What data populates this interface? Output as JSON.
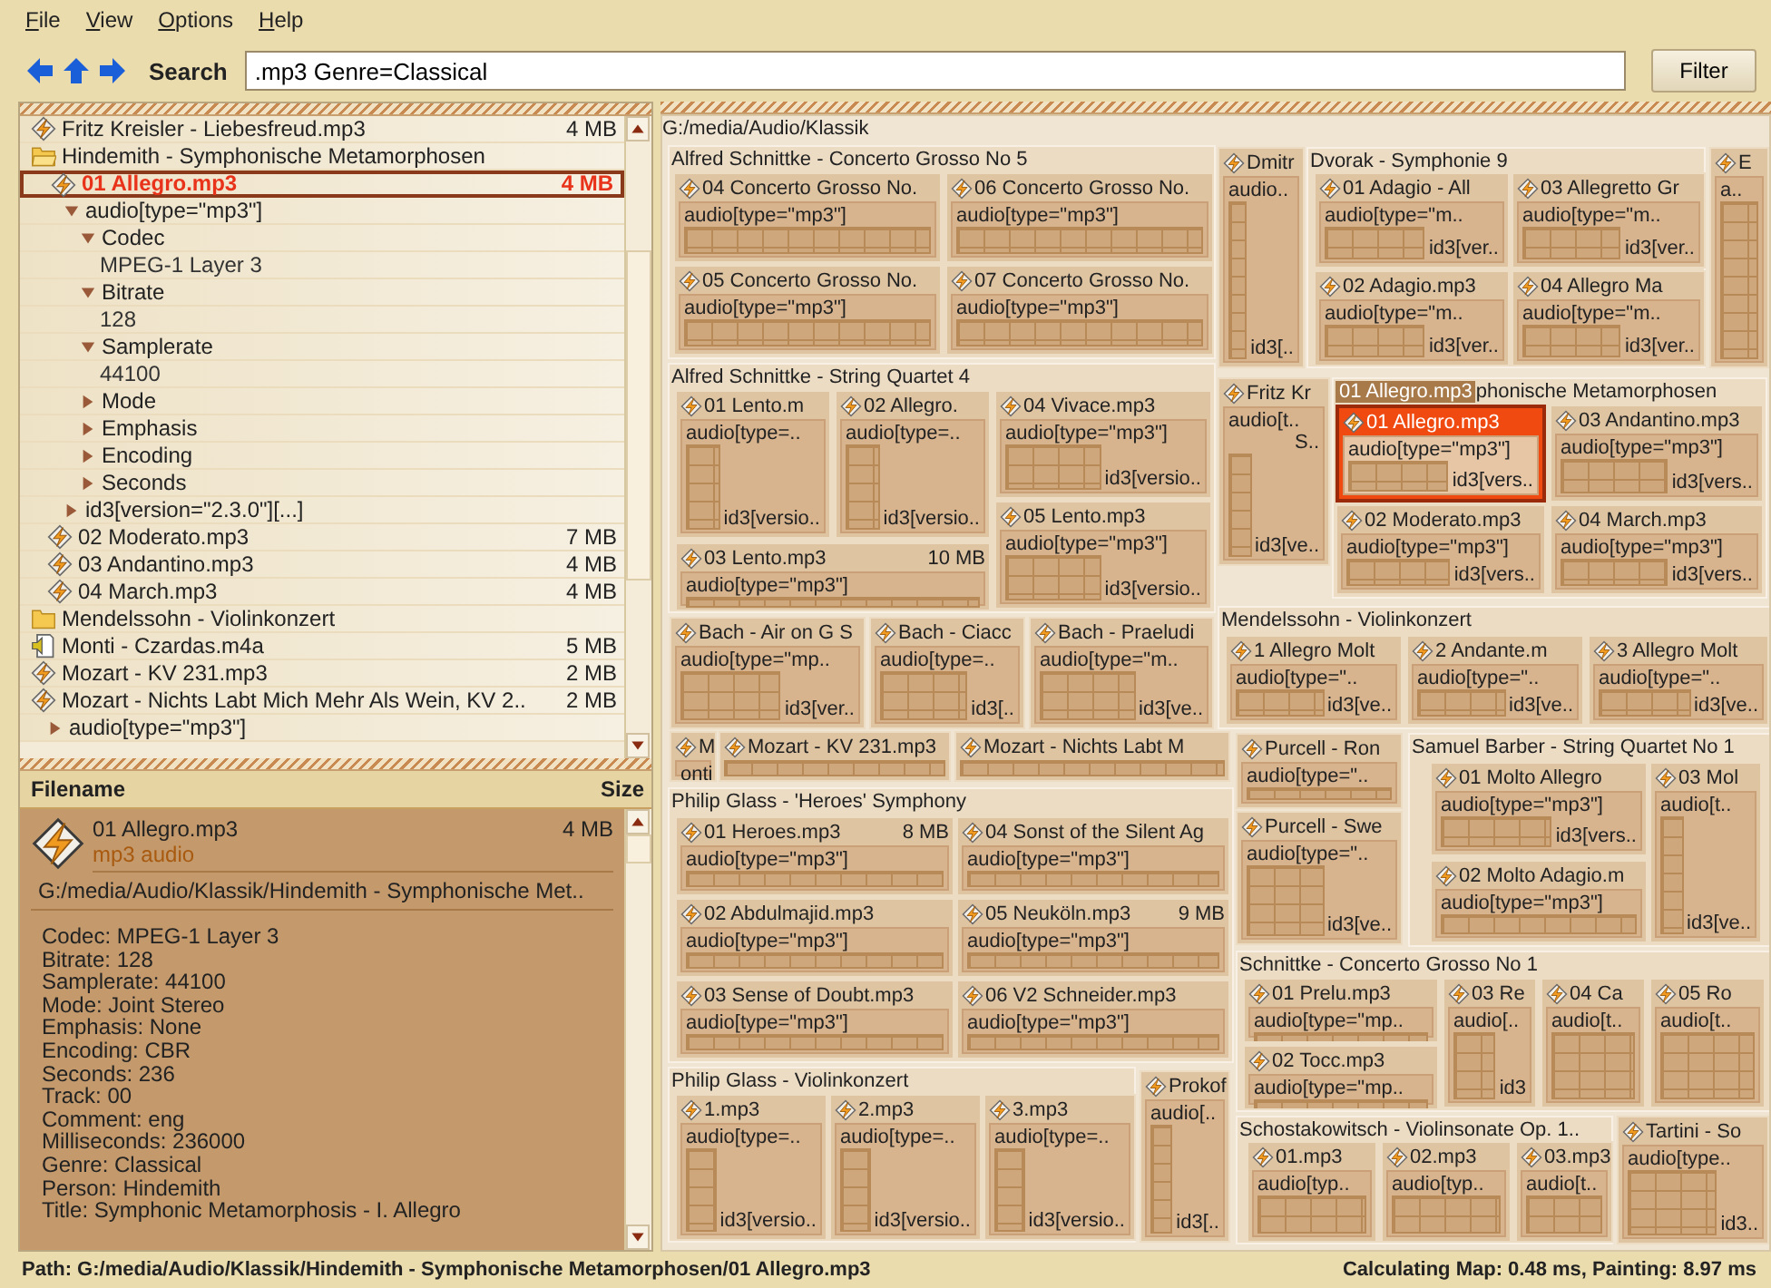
{
  "menu": [
    "File",
    "View",
    "Options",
    "Help"
  ],
  "toolbar": {
    "search_label": "Search",
    "search_value": ".mp3 Genre=Classical",
    "filter_button": "Filter"
  },
  "tree": [
    {
      "kind": "file",
      "name": "Fritz Kreisler - Liebesfreud.mp3",
      "size": "4 MB",
      "selected": false
    },
    {
      "kind": "folder",
      "name": "Hindemith - Symphonische Metamorphosen",
      "expanded": true,
      "children": [
        {
          "kind": "file",
          "name": "01 Allegro.mp3",
          "size": "4 MB",
          "selected": true,
          "children": [
            {
              "kind": "node",
              "name": "audio[type=\"mp3\"]",
              "expanded": true,
              "children": [
                {
                  "kind": "node",
                  "name": "Codec",
                  "expanded": true,
                  "children": [
                    {
                      "kind": "value",
                      "name": "MPEG-1 Layer 3"
                    }
                  ]
                },
                {
                  "kind": "node",
                  "name": "Bitrate",
                  "expanded": true,
                  "children": [
                    {
                      "kind": "value",
                      "name": "128"
                    }
                  ]
                },
                {
                  "kind": "node",
                  "name": "Samplerate",
                  "expanded": true,
                  "children": [
                    {
                      "kind": "value",
                      "name": "44100"
                    }
                  ]
                },
                {
                  "kind": "node",
                  "name": "Mode",
                  "expanded": false
                },
                {
                  "kind": "node",
                  "name": "Emphasis",
                  "expanded": false
                },
                {
                  "kind": "node",
                  "name": "Encoding",
                  "expanded": false
                },
                {
                  "kind": "node",
                  "name": "Seconds",
                  "expanded": false
                }
              ]
            },
            {
              "kind": "node",
              "name": "id3[version=\"2.3.0\"][...]",
              "expanded": false
            }
          ]
        },
        {
          "kind": "file",
          "name": "02 Moderato.mp3",
          "size": "7 MB",
          "selected": false
        },
        {
          "kind": "file",
          "name": "03 Andantino.mp3",
          "size": "4 MB",
          "selected": false
        },
        {
          "kind": "file",
          "name": "04 March.mp3",
          "size": "4 MB",
          "selected": false
        }
      ]
    },
    {
      "kind": "folder",
      "name": "Mendelssohn - Violinkonzert",
      "expanded": false
    },
    {
      "kind": "m4a",
      "name": "Monti - Czardas.m4a",
      "size": "5 MB",
      "selected": false
    },
    {
      "kind": "file",
      "name": "Mozart - KV 231.mp3",
      "size": "2 MB",
      "selected": false
    },
    {
      "kind": "file",
      "name": "Mozart - Nichts Labt Mich Mehr Als Wein, KV 2..",
      "size": "2 MB",
      "selected": false,
      "children": [
        {
          "kind": "node",
          "name": "audio[type=\"mp3\"]",
          "expanded": false
        }
      ]
    }
  ],
  "details": {
    "header_name": "Filename",
    "header_size": "Size",
    "name": "01 Allegro.mp3",
    "size": "4 MB",
    "type": "mp3 audio",
    "path": "G:/media/Audio/Klassik/Hindemith - Symphonische Met..",
    "properties": [
      "Codec: MPEG-1 Layer 3",
      "Bitrate: 128",
      "Samplerate: 44100",
      "Mode: Joint Stereo",
      "Emphasis: None",
      "Encoding: CBR",
      "Seconds: 236",
      "Track: 00",
      "Comment: eng",
      "Milliseconds: 236000",
      "Genre: Classical",
      "Person: Hindemith",
      "Title: Symphonic Metamorphosis - I. Allegro"
    ]
  },
  "treemap": {
    "root": "G:/media/Audio/Klassik",
    "tooltip": "01 Allegro.mp3",
    "items": [
      {
        "kind": "folder",
        "title": "Alfred Schnittke - Concerto Grosso No 5",
        "files": [
          {
            "name": "04 Concerto Grosso No.",
            "audio": "audio[type=\"mp3\"]",
            "selected": false
          },
          {
            "name": "06 Concerto Grosso No.",
            "audio": "audio[type=\"mp3\"]",
            "selected": false
          },
          {
            "name": "05 Concerto Grosso No.",
            "audio": "audio[type=\"mp3\"]",
            "selected": false
          },
          {
            "name": "07 Concerto Grosso No.",
            "audio": "audio[type=\"mp3\"]",
            "selected": false
          }
        ]
      },
      {
        "kind": "folder",
        "title": "Alfred Schnittke - String Quartet 4",
        "files": [
          {
            "name": "01 Lento.m",
            "audio": "audio[type=..",
            "id3": "id3[versio..",
            "selected": false
          },
          {
            "name": "02 Allegro.",
            "audio": "audio[type=..",
            "id3": "id3[versio..",
            "selected": false
          },
          {
            "name": "04 Vivace.mp3",
            "audio": "audio[type=\"mp3\"]",
            "id3": "id3[versio..",
            "selected": false
          },
          {
            "name": "03 Lento.mp3",
            "size": "10 MB",
            "audio": "audio[type=\"mp3\"]",
            "selected": false
          },
          {
            "name": "05 Lento.mp3",
            "audio": "audio[type=\"mp3\"]",
            "id3": "id3[versio..",
            "selected": false
          }
        ]
      },
      {
        "kind": "file",
        "name": "Bach - Air on G S",
        "audio": "audio[type=\"mp..",
        "id3": "id3[ver..",
        "selected": false
      },
      {
        "kind": "file",
        "name": "Bach - Ciacc",
        "audio": "audio[type=..",
        "id3": "id3[..",
        "selected": false
      },
      {
        "kind": "file",
        "name": "Bach - Praeludi",
        "audio": "audio[type=\"m..",
        "id3": "id3[ve..",
        "selected": false
      },
      {
        "kind": "file",
        "name": "Dmitr",
        "audio": "audio..",
        "id3": "id3[..",
        "selected": false
      },
      {
        "kind": "folder",
        "title": "Dvorak - Symphonie 9",
        "files": [
          {
            "name": "01 Adagio - All",
            "audio": "audio[type=\"m..",
            "id3": "id3[ver..",
            "selected": false
          },
          {
            "name": "03 Allegretto Gr",
            "audio": "audio[type=\"m..",
            "id3": "id3[ver..",
            "selected": false
          },
          {
            "name": "02 Adagio.mp3",
            "audio": "audio[type=\"m..",
            "id3": "id3[ver..",
            "selected": false
          },
          {
            "name": "04 Allegro Ma",
            "audio": "audio[type=\"m..",
            "id3": "id3[ver..",
            "selected": false
          }
        ]
      },
      {
        "kind": "file",
        "name": "E",
        "audio": "a..",
        "selected": false
      },
      {
        "kind": "file",
        "name": "Fritz Kr",
        "audio": "audio[t..",
        "extra": "S..",
        "id3": "id3[ve..",
        "selected": false
      },
      {
        "kind": "folder",
        "title": "phonische Metamorphosen",
        "files": [
          {
            "name": "01 Allegro.mp3",
            "audio": "audio[type=\"mp3\"]",
            "id3": "id3[vers..",
            "selected": true
          },
          {
            "name": "03 Andantino.mp3",
            "audio": "audio[type=\"mp3\"]",
            "id3": "id3[vers..",
            "selected": false
          },
          {
            "name": "02 Moderato.mp3",
            "audio": "audio[type=\"mp3\"]",
            "id3": "id3[vers..",
            "selected": false
          },
          {
            "name": "04 March.mp3",
            "audio": "audio[type=\"mp3\"]",
            "id3": "id3[vers..",
            "selected": false
          }
        ]
      },
      {
        "kind": "folder",
        "title": "Mendelssohn - Violinkonzert",
        "files": [
          {
            "name": "1 Allegro Molt",
            "audio": "audio[type=\"..",
            "id3": "id3[ve..",
            "selected": false
          },
          {
            "name": "2 Andante.m",
            "audio": "audio[type=\"..",
            "id3": "id3[ve..",
            "selected": false
          },
          {
            "name": "3 Allegro Molt",
            "audio": "audio[type=\"..",
            "id3": "id3[ve..",
            "selected": false
          }
        ]
      },
      {
        "kind": "file",
        "name": "M",
        "audio": "onti",
        "selected": false
      },
      {
        "kind": "file",
        "name": "Mozart - KV 231.mp3",
        "selected": false
      },
      {
        "kind": "file",
        "name": "Mozart - Nichts Labt M",
        "selected": false
      },
      {
        "kind": "file",
        "name": "Purcell - Ron",
        "audio": "audio[type=\"..",
        "selected": false
      },
      {
        "kind": "file",
        "name": "Purcell - Swe",
        "audio": "audio[type=\"..",
        "id3": "id3[ve..",
        "selected": false
      },
      {
        "kind": "folder",
        "title": "Samuel Barber - String Quartet No 1",
        "files": [
          {
            "name": "01 Molto Allegro",
            "audio": "audio[type=\"mp3\"]",
            "id3": "id3[vers..",
            "selected": false
          },
          {
            "name": "02 Molto Adagio.m",
            "audio": "audio[type=\"mp3\"]",
            "selected": false
          },
          {
            "name": "03 Mol",
            "audio": "audio[t..",
            "id3": "id3[ve..",
            "selected": false
          }
        ]
      },
      {
        "kind": "folder",
        "title": "Philip Glass - 'Heroes' Symphony",
        "files": [
          {
            "name": "01 Heroes.mp3",
            "size": "8 MB",
            "audio": "audio[type=\"mp3\"]",
            "selected": false
          },
          {
            "name": "04 Sonst of the Silent Ag",
            "audio": "audio[type=\"mp3\"]",
            "selected": false
          },
          {
            "name": "02 Abdulmajid.mp3",
            "audio": "audio[type=\"mp3\"]",
            "selected": false
          },
          {
            "name": "05 Neuköln.mp3",
            "size": "9 MB",
            "audio": "audio[type=\"mp3\"]",
            "selected": false
          },
          {
            "name": "03 Sense of Doubt.mp3",
            "audio": "audio[type=\"mp3\"]",
            "selected": false
          },
          {
            "name": "06 V2 Schneider.mp3",
            "audio": "audio[type=\"mp3\"]",
            "selected": false
          }
        ]
      },
      {
        "kind": "folder",
        "title": "Philip Glass - Violinkonzert",
        "files": [
          {
            "name": "1.mp3",
            "audio": "audio[type=..",
            "id3": "id3[versio..",
            "selected": false
          },
          {
            "name": "2.mp3",
            "audio": "audio[type=..",
            "id3": "id3[versio..",
            "selected": false
          },
          {
            "name": "3.mp3",
            "audio": "audio[type=..",
            "id3": "id3[versio..",
            "selected": false
          }
        ]
      },
      {
        "kind": "file",
        "name": "Prokof",
        "audio": "audio[..",
        "id3": "id3[..",
        "selected": false
      },
      {
        "kind": "folder",
        "title": "Schnittke - Concerto Grosso No 1",
        "files": [
          {
            "name": "01 Prelu.mp3",
            "audio": "audio[type=\"mp..",
            "selected": false
          },
          {
            "name": "02 Tocc.mp3",
            "audio": "audio[type=\"mp..",
            "selected": false
          },
          {
            "name": "03 Re",
            "audio": "audio[..",
            "id3": "id3",
            "selected": false
          },
          {
            "name": "04 Ca",
            "audio": "audio[t..",
            "selected": false
          },
          {
            "name": "05 Ro",
            "audio": "audio[t..",
            "selected": false
          }
        ]
      },
      {
        "kind": "folder",
        "title": "Schostakowitsch - Violinsonate Op. 1..",
        "files": [
          {
            "name": "01.mp3",
            "audio": "audio[typ..",
            "selected": false
          },
          {
            "name": "02.mp3",
            "audio": "audio[typ..",
            "selected": false
          },
          {
            "name": "03.mp3",
            "audio": "audio[t..",
            "selected": false
          }
        ]
      },
      {
        "kind": "file",
        "name": "Tartini - So",
        "audio": "audio[type..",
        "id3": "id3..",
        "selected": false
      }
    ]
  },
  "status": {
    "path": "Path: G:/media/Audio/Klassik/Hindemith - Symphonische Metamorphosen/01 Allegro.mp3",
    "timing": "Calculating Map: 0.48 ms, Painting: 8.97 ms"
  }
}
